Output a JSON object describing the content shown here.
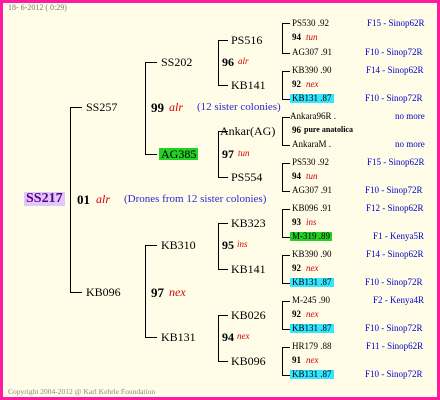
{
  "header": "18- 6-2012 ( 0:29)",
  "footer": "Copyright 2004-2012 @ Karl Kehrle Foundation",
  "root": {
    "id": "SS217",
    "gen": "01",
    "race": "alr",
    "note": "(Drones from 12 sister colonies)"
  },
  "mother": {
    "id": "SS257",
    "gen": "99",
    "race": "alr",
    "note": "(12 sister colonies)"
  },
  "father": {
    "id": "KB096",
    "gen": "97",
    "race": "nex"
  },
  "g3": [
    {
      "id": "SS202",
      "gen": "96",
      "race": "alr"
    },
    {
      "id": "AG385",
      "gen": "97",
      "race": "tun"
    },
    {
      "id": "KB310",
      "gen": "95",
      "race": "ins"
    },
    {
      "id": "KB131",
      "gen": "94",
      "race": "nex"
    }
  ],
  "g4": [
    {
      "id": "PS516",
      "gen": "94",
      "race": "tun"
    },
    {
      "id": "KB141",
      "gen": "92",
      "race": "nex"
    },
    {
      "id": "Ankar(AG)",
      "gen": "96",
      "race": "pure anatolica"
    },
    {
      "id": "PS554",
      "gen": "94",
      "race": "tun"
    },
    {
      "id": "KB323",
      "gen": "93",
      "race": "ins"
    },
    {
      "id": "KB141",
      "gen": "92",
      "race": "nex"
    },
    {
      "id": "KB026",
      "gen": "92",
      "race": "nex"
    },
    {
      "id": "KB096",
      "gen": "91",
      "race": "nex"
    }
  ],
  "g5": [
    {
      "id": "PS530 .92",
      "loc": "F15 - Sinop62R"
    },
    {
      "id": "AG307 .91",
      "loc": "F10 - Sinop72R"
    },
    {
      "id": "KB390 .90",
      "loc": "F14 - Sinop62R"
    },
    {
      "id": "KB131 .87",
      "loc": "F10 - Sinop72R"
    },
    {
      "id": "Ankara96R .",
      "loc": "no more"
    },
    {
      "id": "AnkaraM .",
      "loc": "no more"
    },
    {
      "id": "PS530 .92",
      "loc": "F15 - Sinop62R"
    },
    {
      "id": "AG307 .91",
      "loc": "F10 - Sinop72R"
    },
    {
      "id": "KB096 .91",
      "loc": "F12 - Sinop62R"
    },
    {
      "id": "M-319 .89",
      "loc": "F1 - Kenya5R"
    },
    {
      "id": "KB390 .90",
      "loc": "F14 - Sinop62R"
    },
    {
      "id": "KB131 .87",
      "loc": "F10 - Sinop72R"
    },
    {
      "id": "M-245 .90",
      "loc": "F2 - Kenya4R"
    },
    {
      "id": "KB131 .87",
      "loc": "F10 - Sinop72R"
    },
    {
      "id": "HR179 .88",
      "loc": "F11 - Sinop62R"
    },
    {
      "id": "KB131 .87",
      "loc": "F10 - Sinop72R"
    }
  ]
}
